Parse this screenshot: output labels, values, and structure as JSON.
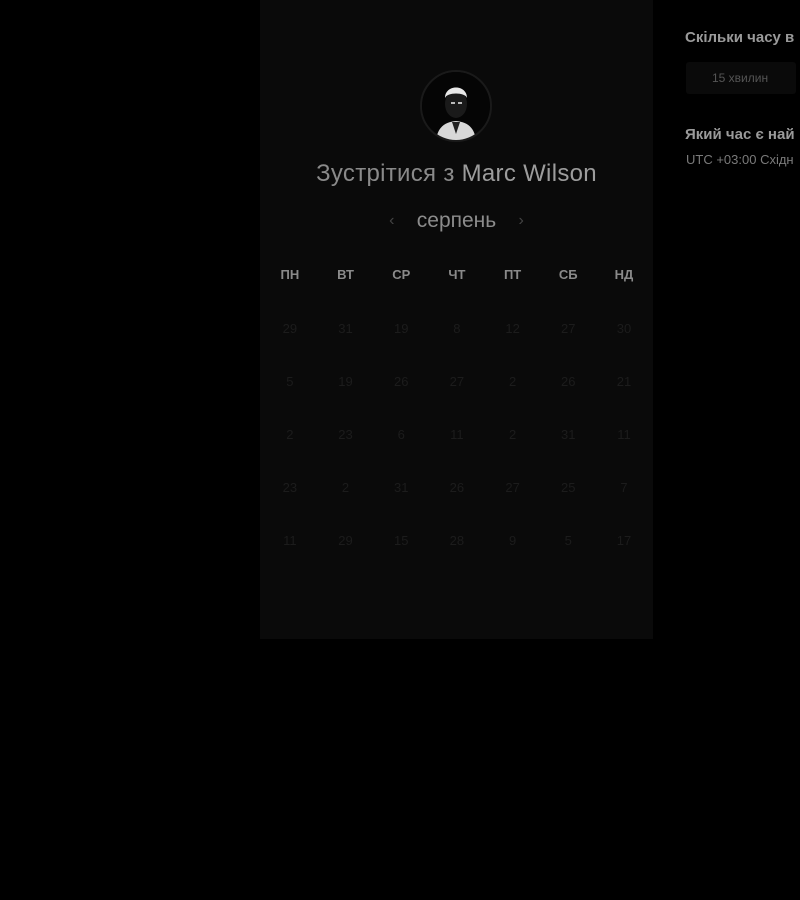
{
  "booking": {
    "title_prefix": "Зустрітися з",
    "host_name": "Marc Wilson",
    "month": "серпень",
    "prev_icon": "chevron-left-icon",
    "next_icon": "chevron-right-icon"
  },
  "calendar": {
    "weekdays": [
      "ПН",
      "ВТ",
      "СР",
      "ЧТ",
      "ПТ",
      "СБ",
      "НД"
    ],
    "weeks": [
      [
        "29",
        "31",
        "19",
        "8",
        "12",
        "27",
        "30"
      ],
      [
        "5",
        "19",
        "26",
        "27",
        "2",
        "26",
        "21"
      ],
      [
        "2",
        "23",
        "6",
        "11",
        "2",
        "31",
        "11"
      ],
      [
        "23",
        "2",
        "31",
        "26",
        "27",
        "25",
        "7"
      ],
      [
        "11",
        "29",
        "15",
        "28",
        "9",
        "5",
        "17"
      ]
    ]
  },
  "side_panel": {
    "duration_question": "Скільки часу в",
    "duration_option": "15 хвилин",
    "time_question": "Який час є най",
    "timezone": "UTC +03:00 Східн"
  },
  "colors": {
    "background": "#000000",
    "card": "#0a0a0a",
    "text_muted": "#8a8a8a"
  }
}
